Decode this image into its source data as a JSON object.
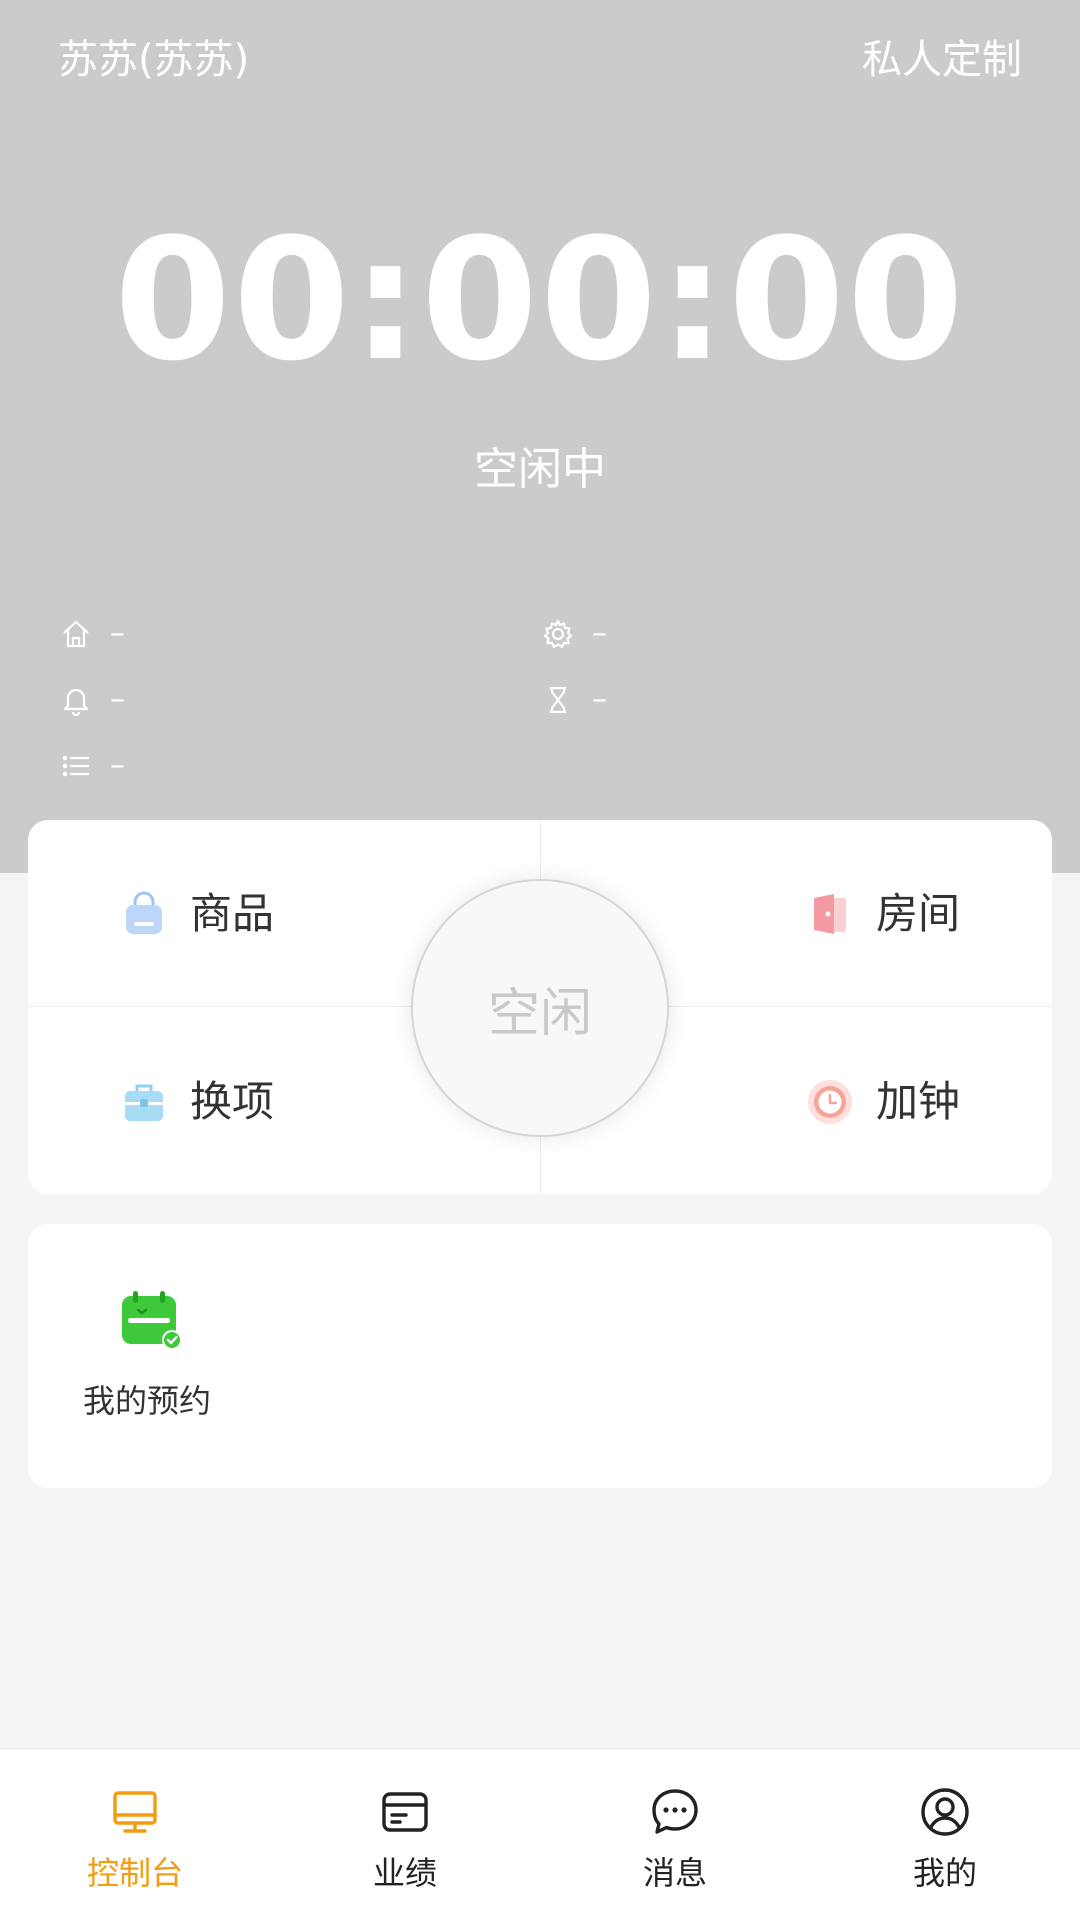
{
  "header": {
    "user_name": "苏苏(苏苏)",
    "custom_link": "私人定制",
    "timer": "00:00:00",
    "status": "空闲中",
    "info": {
      "room": {
        "icon": "home-icon",
        "value": "–"
      },
      "setting": {
        "icon": "gear-icon",
        "value": "–"
      },
      "notice": {
        "icon": "bell-icon",
        "value": "–"
      },
      "duration": {
        "icon": "hourglass-icon",
        "value": "–"
      },
      "list": {
        "icon": "list-icon",
        "value": "–"
      }
    }
  },
  "actions": {
    "goods": {
      "label": "商品",
      "icon": "shopping-bag-icon"
    },
    "room": {
      "label": "房间",
      "icon": "door-icon"
    },
    "switch": {
      "label": "换项",
      "icon": "toolbox-icon"
    },
    "add_time": {
      "label": "加钟",
      "icon": "clock-icon"
    },
    "center": {
      "label": "空闲"
    }
  },
  "booking": {
    "label": "我的预约",
    "icon": "calendar-check-icon"
  },
  "tabbar": {
    "tabs": [
      {
        "label": "控制台",
        "icon": "monitor-icon",
        "active": true
      },
      {
        "label": "业绩",
        "icon": "card-icon",
        "active": false
      },
      {
        "label": "消息",
        "icon": "chat-icon",
        "active": false
      },
      {
        "label": "我的",
        "icon": "user-circle-icon",
        "active": false
      }
    ]
  },
  "colors": {
    "header_bg": "#cbcbcb",
    "accent": "#f39c12",
    "page_bg": "#f5f5f5"
  }
}
